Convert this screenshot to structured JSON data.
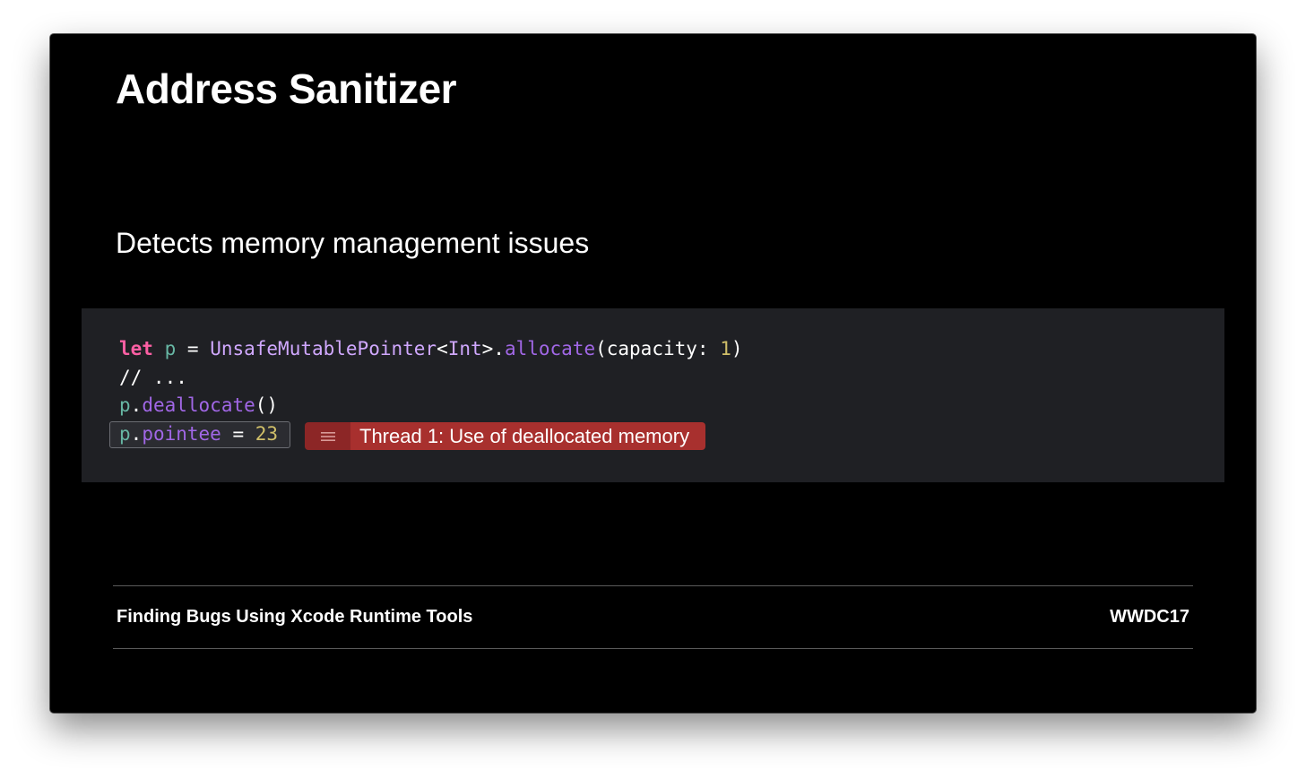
{
  "slide": {
    "title": "Address Sanitizer",
    "subtitle": "Detects memory management issues"
  },
  "code": {
    "line1": {
      "kw_let": "let",
      "var_p": "p",
      "eq": " = ",
      "type_unsafe": "UnsafeMutablePointer",
      "lt": "<",
      "type_int": "Int",
      "gt_dot": ">.",
      "fn_allocate": "allocate",
      "args_open": "(capacity: ",
      "num_one": "1",
      "args_close": ")"
    },
    "line2": "// ...",
    "line3": {
      "var_p": "p",
      "dot": ".",
      "fn_deallocate": "deallocate",
      "parens": "()"
    },
    "line4": {
      "var_p": "p",
      "dot": ".",
      "fn_pointee": "pointee",
      "eq": " = ",
      "num": "23"
    }
  },
  "error": {
    "icon": "list-lines-icon",
    "message": "Thread 1: Use of deallocated memory",
    "colors": {
      "badge": "#a8302e",
      "icon_box": "#8c2626"
    }
  },
  "footer": {
    "session_title": "Finding Bugs Using Xcode Runtime Tools",
    "event": "WWDC17"
  },
  "colors": {
    "background": "#000000",
    "code_panel": "#1f2024",
    "keyword": "#fc5fa3",
    "variable": "#67b7a4",
    "type": "#d0a8ff",
    "function": "#a167e6",
    "number": "#d0bf69"
  }
}
